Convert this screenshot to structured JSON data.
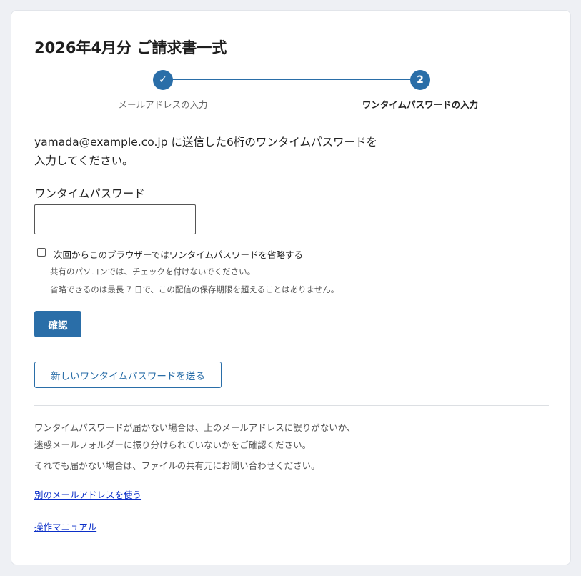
{
  "page": {
    "title": "2026年4月分 ご請求書一式"
  },
  "stepper": {
    "steps": [
      {
        "marker": "✓",
        "label": "メールアドレスの入力",
        "state": "completed"
      },
      {
        "marker": "2",
        "label": "ワンタイムパスワードの入力",
        "state": "current"
      }
    ]
  },
  "instruction": {
    "line1": "yamada@example.co.jp に送信した6桁のワンタイムパスワードを",
    "line2": "入力してください。"
  },
  "otp": {
    "label": "ワンタイムパスワード",
    "value": "",
    "placeholder": ""
  },
  "skip_option": {
    "label": "次回からこのブラウザーではワンタイムパスワードを省略する",
    "checked": false,
    "note1": "共有のパソコンでは、チェックを付けないでください。",
    "note2": "省略できるのは最長 7 日で、この配信の保存期限を超えることはありません。"
  },
  "buttons": {
    "confirm": "確認",
    "resend": "新しいワンタイムパスワードを送る"
  },
  "help": {
    "line1": "ワンタイムパスワードが届かない場合は、上のメールアドレスに誤りがないか、",
    "line2": "迷惑メールフォルダーに振り分けられていないかをご確認ください。",
    "line3": "それでも届かない場合は、ファイルの共有元にお問い合わせください。"
  },
  "links": {
    "other_email": "別のメールアドレスを使う",
    "manual": "操作マニュアル"
  },
  "colors": {
    "accent": "#2a6ea8",
    "link": "#0b2fc8",
    "background": "#eef0f4"
  },
  "icons": {
    "step1": "check-icon"
  }
}
